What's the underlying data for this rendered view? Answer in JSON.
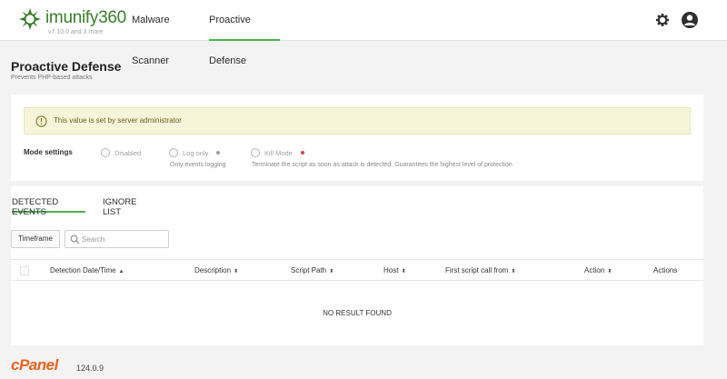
{
  "brand": {
    "name": "imunify360",
    "version": "v7.10.0 and 3 more",
    "color": "#3a7d2b"
  },
  "nav": {
    "malware_scanner": "Malware Scanner",
    "proactive_defense": "Proactive Defense",
    "active": "proactive_defense"
  },
  "icons": {
    "settings": "gear-icon",
    "account": "user-avatar-icon",
    "info": "info-icon",
    "search": "search-icon",
    "sort": "sort-icon"
  },
  "page": {
    "title": "Proactive Defense",
    "subtitle": "Prevents PHP-based attacks"
  },
  "alert": {
    "text": "This value is set by server administrator",
    "color": "#f6f5da"
  },
  "mode_settings": {
    "label": "Mode settings",
    "options": [
      {
        "label": "Disabled",
        "hint": ""
      },
      {
        "label": "Log only",
        "hint": "Only events logging"
      },
      {
        "label": "Kill Mode",
        "hint": "Terminate the script as soon as attack is detected. Guarantees the highest level of protection"
      }
    ]
  },
  "tabs": {
    "detected_events": "DETECTED EVENTS",
    "ignore_list": "IGNORE LIST",
    "active": "detected_events",
    "accent": "#4cb050"
  },
  "filters": {
    "timeframe_label": "Timeframe",
    "search_placeholder": "Search",
    "search_value": ""
  },
  "table": {
    "columns": [
      "Detection Date/Time",
      "Description",
      "Script Path",
      "Host",
      "First script call from",
      "Action",
      "Actions"
    ],
    "sort_glyphs": [
      "▲",
      "⬍",
      "⬍",
      "⬍",
      "⬍",
      "⬍"
    ],
    "empty_text": "NO RESULT FOUND"
  },
  "footer": {
    "cpanel_logo": "cPanel",
    "cpanel_version": "124.0.9"
  }
}
